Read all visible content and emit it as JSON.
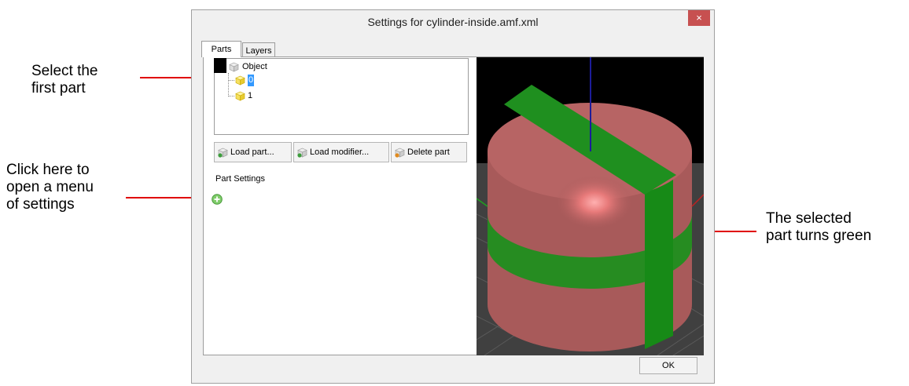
{
  "annotations": {
    "select_first_part": [
      "Select the",
      "first part"
    ],
    "click_here": [
      "Click here to",
      "open a menu",
      "of settings"
    ],
    "selected_part": [
      "The selected",
      "part turns green"
    ],
    "arrow_color": "#e00000"
  },
  "dialog": {
    "title": "Settings for cylinder-inside.amf.xml",
    "close_label": "×",
    "tabs": [
      {
        "label": "Parts",
        "active": true
      },
      {
        "label": "Layers",
        "active": false
      }
    ],
    "tree": {
      "root_label": "Object",
      "items": [
        {
          "label": "0",
          "selected": true
        },
        {
          "label": "1",
          "selected": false
        }
      ]
    },
    "buttons": {
      "load_part": "Load part...",
      "load_modifier": "Load modifier...",
      "delete_part": "Delete part"
    },
    "part_settings_label": "Part Settings",
    "ok_label": "OK"
  },
  "colors": {
    "selected_part": "#1f8f1f",
    "cylinder": "#a85a5a",
    "viewport_bg": "#404040",
    "selection_highlight": "#3399ff"
  }
}
